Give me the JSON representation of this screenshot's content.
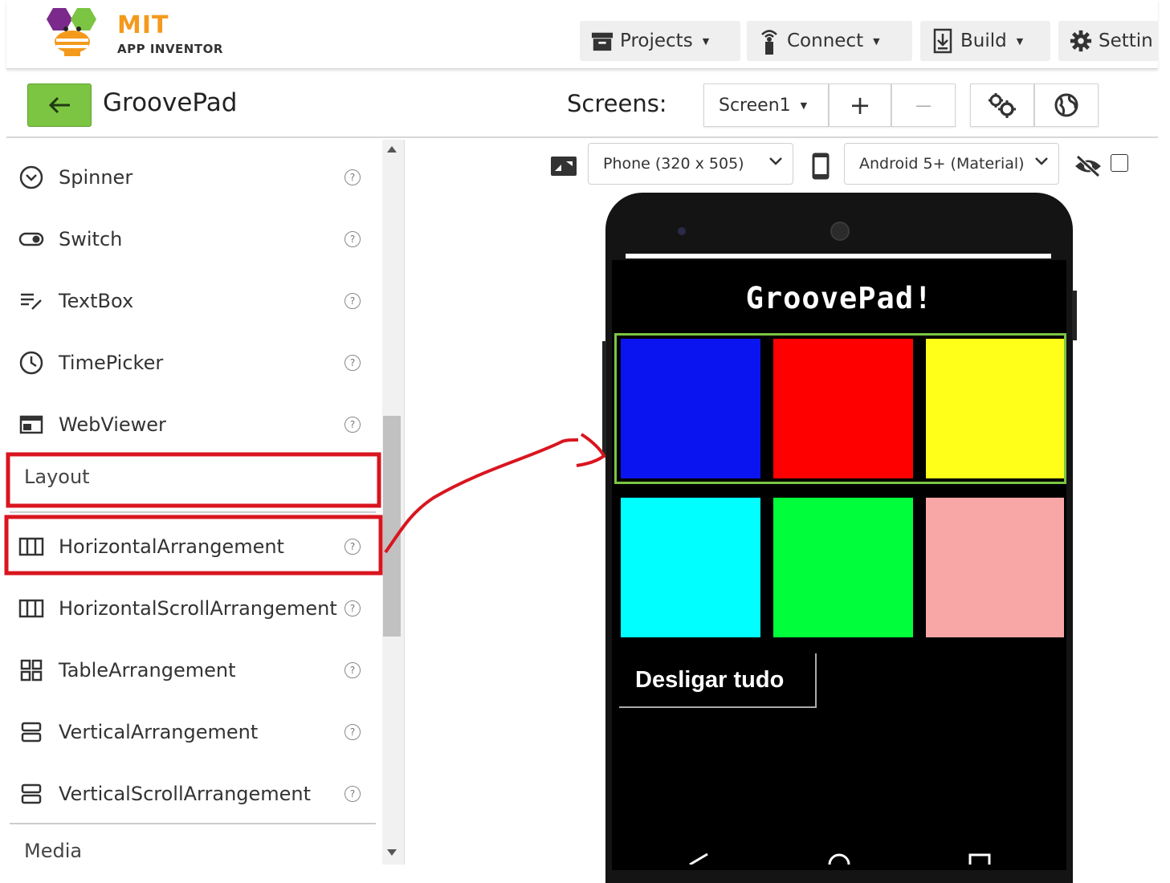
{
  "header": {
    "logo_title": "MIT",
    "logo_subtitle": "APP INVENTOR",
    "menus": [
      {
        "label": "Projects",
        "icon": "folder-icon"
      },
      {
        "label": "Connect",
        "icon": "antenna-icon"
      },
      {
        "label": "Build",
        "icon": "download-icon"
      },
      {
        "label": "Settin",
        "icon": "gear-icon"
      }
    ]
  },
  "toolbar": {
    "project_name": "GroovePad",
    "screens_label": "Screens:",
    "screen_select": "Screen1",
    "add_label": "+",
    "remove_label": "—"
  },
  "palette": {
    "items_top": [
      {
        "label": "Spinner",
        "icon": "spinner-icon"
      },
      {
        "label": "Switch",
        "icon": "switch-icon"
      },
      {
        "label": "TextBox",
        "icon": "textbox-icon"
      },
      {
        "label": "TimePicker",
        "icon": "clock-icon"
      },
      {
        "label": "WebViewer",
        "icon": "webviewer-icon"
      }
    ],
    "section_layout": "Layout",
    "items_layout": [
      {
        "label": "HorizontalArrangement",
        "icon": "horizontal-arrangement-icon"
      },
      {
        "label": "HorizontalScrollArrangement",
        "icon": "horizontal-scroll-arrangement-icon"
      },
      {
        "label": "TableArrangement",
        "icon": "table-arrangement-icon"
      },
      {
        "label": "VerticalArrangement",
        "icon": "vertical-arrangement-icon"
      },
      {
        "label": "VerticalScrollArrangement",
        "icon": "vertical-scroll-arrangement-icon"
      }
    ],
    "section_media": "Media",
    "help_glyph": "?"
  },
  "viewer": {
    "device_select": "Phone (320 x 505)",
    "theme_select": "Android 5+ (Material)"
  },
  "app": {
    "title": "GroovePad!",
    "pad_colors_row1": [
      "#0a14f0",
      "#ff0000",
      "#ffff1a"
    ],
    "pad_colors_row2": [
      "#00ffff",
      "#00ff3a",
      "#f9a6a6"
    ],
    "off_button": "Desligar tudo"
  },
  "colors": {
    "annotation": "#d9151f",
    "selection": "#7cc543",
    "back_button": "#7cc543"
  }
}
